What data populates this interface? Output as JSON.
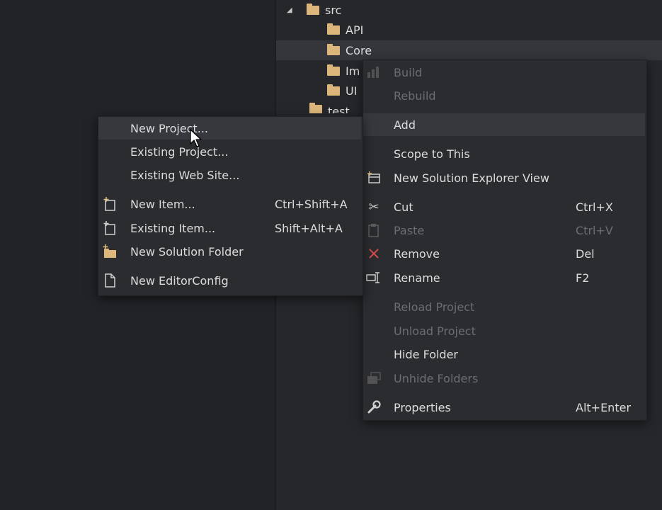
{
  "tree": [
    {
      "label": "src",
      "expanded": true
    },
    {
      "label": "API"
    },
    {
      "label": "Core",
      "selected": true
    },
    {
      "label": "Im"
    },
    {
      "label": "UI"
    },
    {
      "label": "test"
    }
  ],
  "context_menu": {
    "items": [
      {
        "label": "Build",
        "icon": "build-icon",
        "disabled": true
      },
      {
        "label": "Rebuild",
        "disabled": true
      },
      {
        "label": "Add",
        "highlighted": true
      },
      {
        "label": "Scope to This"
      },
      {
        "label": "New Solution Explorer View",
        "icon": "new-view-icon"
      },
      {
        "label": "Cut",
        "icon": "scissors-icon",
        "shortcut": "Ctrl+X"
      },
      {
        "label": "Paste",
        "icon": "clipboard-icon",
        "shortcut": "Ctrl+V",
        "disabled": true
      },
      {
        "label": "Remove",
        "icon": "close-icon",
        "shortcut": "Del"
      },
      {
        "label": "Rename",
        "icon": "rename-icon",
        "shortcut": "F2"
      },
      {
        "label": "Reload Project",
        "disabled": true
      },
      {
        "label": "Unload Project",
        "disabled": true
      },
      {
        "label": "Hide Folder"
      },
      {
        "label": "Unhide Folders",
        "icon": "unhide-icon",
        "disabled": true
      },
      {
        "label": "Properties",
        "icon": "wrench-icon",
        "shortcut": "Alt+Enter"
      }
    ]
  },
  "add_submenu": {
    "items": [
      {
        "label": "New Project...",
        "highlighted": true
      },
      {
        "label": "Existing Project..."
      },
      {
        "label": "Existing Web Site..."
      },
      {
        "label": "New Item...",
        "icon": "new-item-icon",
        "shortcut": "Ctrl+Shift+A"
      },
      {
        "label": "Existing Item...",
        "icon": "existing-item-icon",
        "shortcut": "Shift+Alt+A"
      },
      {
        "label": "New Solution Folder",
        "icon": "new-folder-icon"
      },
      {
        "label": "New EditorConfig",
        "icon": "file-icon"
      }
    ]
  },
  "colors": {
    "folder": "#dcb67a",
    "remove": "#d14b4b",
    "menu_bg": "#2b2c30",
    "highlight": "#36383d",
    "disabled_text": "#6b6d72"
  }
}
